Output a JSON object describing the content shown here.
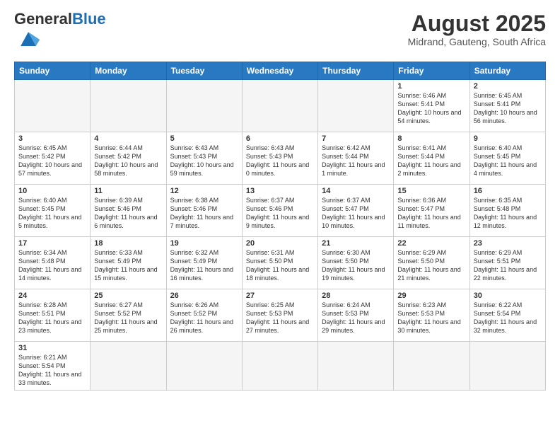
{
  "header": {
    "logo_general": "General",
    "logo_blue": "Blue",
    "month_title": "August 2025",
    "location": "Midrand, Gauteng, South Africa"
  },
  "days_of_week": [
    "Sunday",
    "Monday",
    "Tuesday",
    "Wednesday",
    "Thursday",
    "Friday",
    "Saturday"
  ],
  "weeks": [
    [
      {
        "day": "",
        "info": "",
        "empty": true
      },
      {
        "day": "",
        "info": "",
        "empty": true
      },
      {
        "day": "",
        "info": "",
        "empty": true
      },
      {
        "day": "",
        "info": "",
        "empty": true
      },
      {
        "day": "",
        "info": "",
        "empty": true
      },
      {
        "day": "1",
        "info": "Sunrise: 6:46 AM\nSunset: 5:41 PM\nDaylight: 10 hours\nand 54 minutes."
      },
      {
        "day": "2",
        "info": "Sunrise: 6:45 AM\nSunset: 5:41 PM\nDaylight: 10 hours\nand 56 minutes."
      }
    ],
    [
      {
        "day": "3",
        "info": "Sunrise: 6:45 AM\nSunset: 5:42 PM\nDaylight: 10 hours\nand 57 minutes."
      },
      {
        "day": "4",
        "info": "Sunrise: 6:44 AM\nSunset: 5:42 PM\nDaylight: 10 hours\nand 58 minutes."
      },
      {
        "day": "5",
        "info": "Sunrise: 6:43 AM\nSunset: 5:43 PM\nDaylight: 10 hours\nand 59 minutes."
      },
      {
        "day": "6",
        "info": "Sunrise: 6:43 AM\nSunset: 5:43 PM\nDaylight: 11 hours\nand 0 minutes."
      },
      {
        "day": "7",
        "info": "Sunrise: 6:42 AM\nSunset: 5:44 PM\nDaylight: 11 hours\nand 1 minute."
      },
      {
        "day": "8",
        "info": "Sunrise: 6:41 AM\nSunset: 5:44 PM\nDaylight: 11 hours\nand 2 minutes."
      },
      {
        "day": "9",
        "info": "Sunrise: 6:40 AM\nSunset: 5:45 PM\nDaylight: 11 hours\nand 4 minutes."
      }
    ],
    [
      {
        "day": "10",
        "info": "Sunrise: 6:40 AM\nSunset: 5:45 PM\nDaylight: 11 hours\nand 5 minutes."
      },
      {
        "day": "11",
        "info": "Sunrise: 6:39 AM\nSunset: 5:46 PM\nDaylight: 11 hours\nand 6 minutes."
      },
      {
        "day": "12",
        "info": "Sunrise: 6:38 AM\nSunset: 5:46 PM\nDaylight: 11 hours\nand 7 minutes."
      },
      {
        "day": "13",
        "info": "Sunrise: 6:37 AM\nSunset: 5:46 PM\nDaylight: 11 hours\nand 9 minutes."
      },
      {
        "day": "14",
        "info": "Sunrise: 6:37 AM\nSunset: 5:47 PM\nDaylight: 11 hours\nand 10 minutes."
      },
      {
        "day": "15",
        "info": "Sunrise: 6:36 AM\nSunset: 5:47 PM\nDaylight: 11 hours\nand 11 minutes."
      },
      {
        "day": "16",
        "info": "Sunrise: 6:35 AM\nSunset: 5:48 PM\nDaylight: 11 hours\nand 12 minutes."
      }
    ],
    [
      {
        "day": "17",
        "info": "Sunrise: 6:34 AM\nSunset: 5:48 PM\nDaylight: 11 hours\nand 14 minutes."
      },
      {
        "day": "18",
        "info": "Sunrise: 6:33 AM\nSunset: 5:49 PM\nDaylight: 11 hours\nand 15 minutes."
      },
      {
        "day": "19",
        "info": "Sunrise: 6:32 AM\nSunset: 5:49 PM\nDaylight: 11 hours\nand 16 minutes."
      },
      {
        "day": "20",
        "info": "Sunrise: 6:31 AM\nSunset: 5:50 PM\nDaylight: 11 hours\nand 18 minutes."
      },
      {
        "day": "21",
        "info": "Sunrise: 6:30 AM\nSunset: 5:50 PM\nDaylight: 11 hours\nand 19 minutes."
      },
      {
        "day": "22",
        "info": "Sunrise: 6:29 AM\nSunset: 5:50 PM\nDaylight: 11 hours\nand 21 minutes."
      },
      {
        "day": "23",
        "info": "Sunrise: 6:29 AM\nSunset: 5:51 PM\nDaylight: 11 hours\nand 22 minutes."
      }
    ],
    [
      {
        "day": "24",
        "info": "Sunrise: 6:28 AM\nSunset: 5:51 PM\nDaylight: 11 hours\nand 23 minutes."
      },
      {
        "day": "25",
        "info": "Sunrise: 6:27 AM\nSunset: 5:52 PM\nDaylight: 11 hours\nand 25 minutes."
      },
      {
        "day": "26",
        "info": "Sunrise: 6:26 AM\nSunset: 5:52 PM\nDaylight: 11 hours\nand 26 minutes."
      },
      {
        "day": "27",
        "info": "Sunrise: 6:25 AM\nSunset: 5:53 PM\nDaylight: 11 hours\nand 27 minutes."
      },
      {
        "day": "28",
        "info": "Sunrise: 6:24 AM\nSunset: 5:53 PM\nDaylight: 11 hours\nand 29 minutes."
      },
      {
        "day": "29",
        "info": "Sunrise: 6:23 AM\nSunset: 5:53 PM\nDaylight: 11 hours\nand 30 minutes."
      },
      {
        "day": "30",
        "info": "Sunrise: 6:22 AM\nSunset: 5:54 PM\nDaylight: 11 hours\nand 32 minutes."
      }
    ],
    [
      {
        "day": "31",
        "info": "Sunrise: 6:21 AM\nSunset: 5:54 PM\nDaylight: 11 hours\nand 33 minutes."
      },
      {
        "day": "",
        "info": "",
        "empty": true
      },
      {
        "day": "",
        "info": "",
        "empty": true
      },
      {
        "day": "",
        "info": "",
        "empty": true
      },
      {
        "day": "",
        "info": "",
        "empty": true
      },
      {
        "day": "",
        "info": "",
        "empty": true
      },
      {
        "day": "",
        "info": "",
        "empty": true
      }
    ]
  ]
}
